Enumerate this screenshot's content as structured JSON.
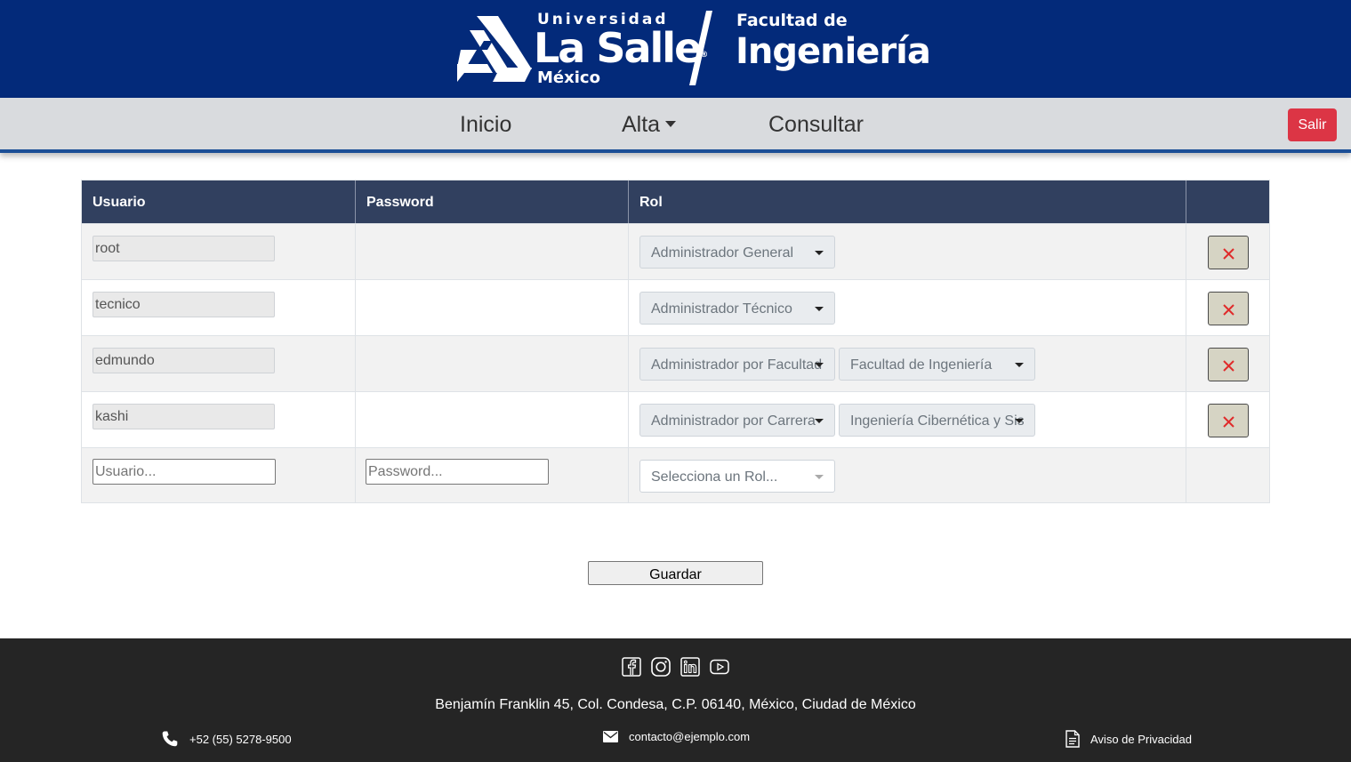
{
  "brand": {
    "universidad": "Universidad",
    "la_salle": "La Salle",
    "reg": "®",
    "mexico": "México",
    "facultad_de": "Facultad de",
    "ingenieria": "Ingeniería"
  },
  "nav": {
    "inicio": "Inicio",
    "alta": "Alta",
    "consultar": "Consultar",
    "salir": "Salir"
  },
  "table": {
    "headers": [
      "Usuario",
      "Password",
      "Rol",
      ""
    ],
    "rows": [
      {
        "usuario": "root",
        "rol": "Administrador General",
        "extra": ""
      },
      {
        "usuario": "tecnico",
        "rol": "Administrador Técnico",
        "extra": ""
      },
      {
        "usuario": "edmundo",
        "rol": "Administrador por Facultad",
        "extra": "Facultad de Ingeniería"
      },
      {
        "usuario": "kashi",
        "rol": "Administrador por Carrera",
        "extra": "Ingeniería Cibernética y Sistemas Computacionales"
      }
    ],
    "new_row": {
      "usuario_placeholder": "Usuario...",
      "password_placeholder": "Password...",
      "rol_placeholder": "Selecciona un Rol..."
    }
  },
  "actions": {
    "guardar": "Guardar"
  },
  "footer": {
    "social": [
      "facebook-icon",
      "instagram-icon",
      "linkedin-icon",
      "youtube-icon"
    ],
    "address": "Benjamín Franklin 45, Col. Condesa, C.P. 06140, México, Ciudad de México",
    "phone": "+52 (55) 5278-9500",
    "email": "contacto@ejemplo.com",
    "privacy": "Aviso de Privacidad"
  },
  "colors": {
    "header_bg": "#032a7a",
    "nav_bg": "#d9dbde",
    "nav_border": "#1c4f96",
    "table_head": "#31405f",
    "danger": "#dc3545",
    "delete_btn": "#d6d4c4",
    "footer_bg": "#252525"
  }
}
